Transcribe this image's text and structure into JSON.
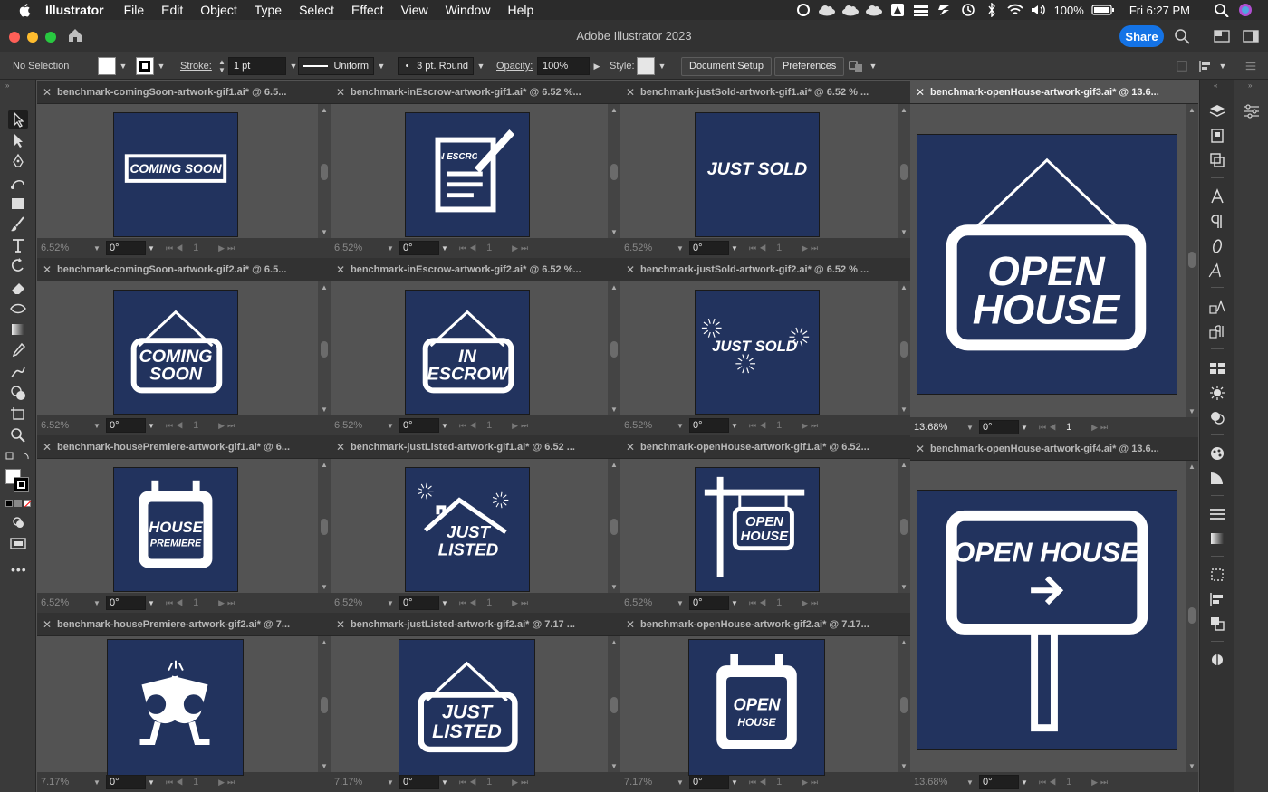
{
  "menubar": {
    "items": [
      "Illustrator",
      "File",
      "Edit",
      "Object",
      "Type",
      "Select",
      "Effect",
      "View",
      "Window",
      "Help"
    ],
    "battery": "100%",
    "datetime": "Fri 6:27 PM"
  },
  "window": {
    "title": "Adobe Illustrator 2023",
    "share_label": "Share"
  },
  "control": {
    "selection": "No Selection",
    "stroke_label": "Stroke:",
    "stroke_value": "1 pt",
    "profile": "Uniform",
    "brush": "3 pt. Round",
    "opacity_label": "Opacity:",
    "opacity_value": "100%",
    "style_label": "Style:",
    "document_setup": "Document Setup",
    "preferences": "Preferences"
  },
  "docs": {
    "d1": {
      "tab": "benchmark-comingSoon-artwork-gif1.ai* @ 6.5...",
      "zoom": "6.52%",
      "rot": "0°",
      "page": "1",
      "art": "COMING SOON"
    },
    "d2": {
      "tab": "benchmark-inEscrow-artwork-gif1.ai* @ 6.52 %...",
      "zoom": "6.52%",
      "rot": "0°",
      "page": "1",
      "art": "IN ESCROW"
    },
    "d3": {
      "tab": "benchmark-justSold-artwork-gif1.ai* @ 6.52 % ...",
      "zoom": "6.52%",
      "rot": "0°",
      "page": "1",
      "art": "JUST SOLD"
    },
    "d4": {
      "tab": "benchmark-openHouse-artwork-gif3.ai* @ 13.6...",
      "zoom": "13.68%",
      "rot": "0°",
      "page": "1",
      "art1": "OPEN",
      "art2": "HOUSE"
    },
    "d5": {
      "tab": "benchmark-comingSoon-artwork-gif2.ai* @ 6.5...",
      "zoom": "6.52%",
      "rot": "0°",
      "page": "1",
      "art1": "COMING",
      "art2": "SOON"
    },
    "d6": {
      "tab": "benchmark-inEscrow-artwork-gif2.ai* @ 6.52 %...",
      "zoom": "6.52%",
      "rot": "0°",
      "page": "1",
      "art1": "IN",
      "art2": "ESCROW"
    },
    "d7": {
      "tab": "benchmark-justSold-artwork-gif2.ai* @ 6.52 % ...",
      "zoom": "6.52%",
      "rot": "0°",
      "page": "1",
      "art": "JUST SOLD"
    },
    "d8": {
      "tab": "benchmark-housePremiere-artwork-gif1.ai* @ 6...",
      "zoom": "6.52%",
      "rot": "0°",
      "page": "1",
      "art1": "HOUSE",
      "art2": "PREMIERE"
    },
    "d9": {
      "tab": "benchmark-justListed-artwork-gif1.ai* @ 6.52 ...",
      "zoom": "6.52%",
      "rot": "0°",
      "page": "1",
      "art1": "JUST",
      "art2": "LISTED"
    },
    "d10": {
      "tab": "benchmark-openHouse-artwork-gif1.ai* @ 6.52...",
      "zoom": "6.52%",
      "rot": "0°",
      "page": "1",
      "art1": "OPEN",
      "art2": "HOUSE"
    },
    "d11": {
      "tab": "benchmark-openHouse-artwork-gif4.ai* @ 13.6...",
      "zoom": "13.68%",
      "rot": "0°",
      "page": "1",
      "art": "OPEN HOUSE"
    },
    "d12": {
      "tab": "benchmark-housePremiere-artwork-gif2.ai* @ 7...",
      "zoom": "7.17%",
      "rot": "0°",
      "page": "1"
    },
    "d13": {
      "tab": "benchmark-justListed-artwork-gif2.ai* @ 7.17 ...",
      "zoom": "7.17%",
      "rot": "0°",
      "page": "1",
      "art1": "JUST",
      "art2": "LISTED"
    },
    "d14": {
      "tab": "benchmark-openHouse-artwork-gif2.ai* @ 7.17...",
      "zoom": "7.17%",
      "rot": "0°",
      "page": "1",
      "art1": "OPEN",
      "art2": "HOUSE"
    }
  },
  "colors": {
    "artboard_bg": "#22335e",
    "accent": "#1473e6"
  }
}
